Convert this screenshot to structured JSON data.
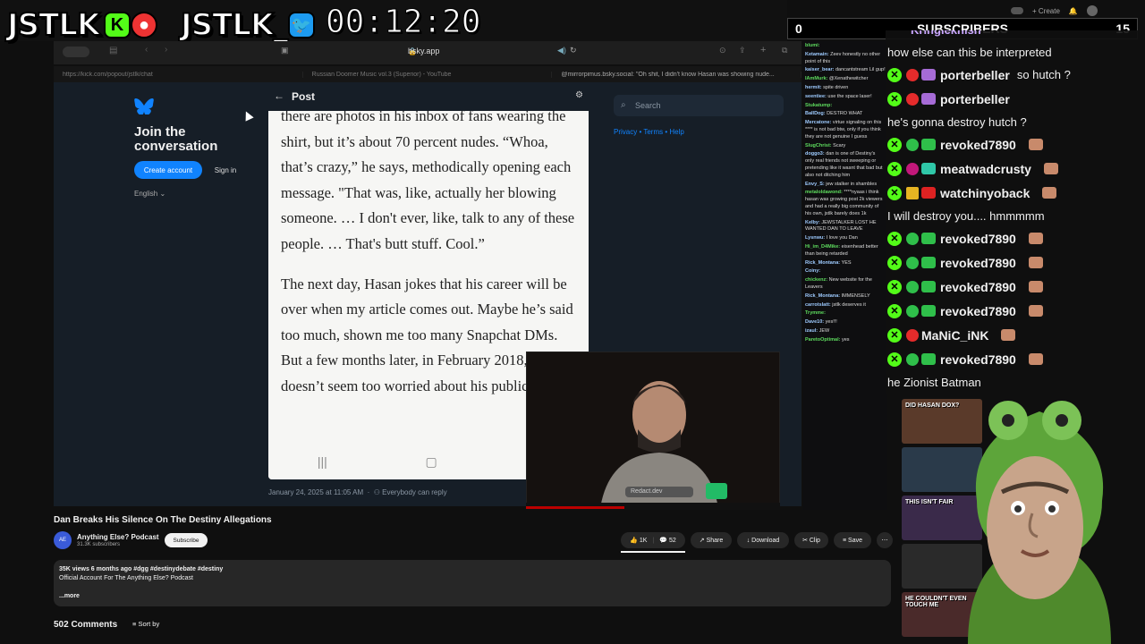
{
  "overlay": {
    "logo1": "JSTLK",
    "logo2": "JSTLK_",
    "kick_glyph": "K",
    "timer": "00:12:20"
  },
  "browser": {
    "url": "bsky.app",
    "tabs": [
      "https://kick.com/popout/jstlk/chat",
      "Russian Doomer Music vol.3 (Superior) - YouTube",
      "@mirrorpimus.bsky.social: \"Oh shit, I didn't know Hasan was showing nude..."
    ]
  },
  "bluesky": {
    "join_title": "Join the conversation",
    "create_account": "Create account",
    "sign_in": "Sign in",
    "language": "English",
    "post_title": "Post",
    "search_placeholder": "Search",
    "side_links": "Privacy • Terms • Help",
    "post_date": "January 24, 2025 at 11:05 AM",
    "reply_setting": "Everybody can reply"
  },
  "article": {
    "para1": "there are photos in his inbox of fans wearing the shirt, but it’s about 70 percent nudes. “Whoa, that’s crazy,” he says, methodically opening each message. \"That was, like, actually her blowing someone. … I don't ever, like, talk to any of these people. … That's butt stuff. Cool.”",
    "para2": "The next day, Hasan jokes that his career will be over when my article comes out. Maybe he’s said too much, shown me too many Snapchat DMs. But a few months later, in February 2018, he doesn’t seem too worried about his public"
  },
  "webcam": {
    "mic_label": "Redact.dev"
  },
  "youtube": {
    "title": "Dan Breaks His Silence On The Destiny Allegations",
    "channel": "Anything Else? Podcast",
    "channel_avatar": "AE",
    "subs": "31.3K subscribers",
    "subscribe": "Subscribe",
    "likes": "1K",
    "comments_icon_count": "52",
    "share": "Share",
    "download": "Download",
    "clip": "Clip",
    "save": "Save",
    "more": "⋯",
    "desc_line1": "35K views  6 months ago  #dgg #destinydebate #destiny",
    "desc_line2": "Official Account For The Anything Else? Podcast",
    "desc_more": "...more",
    "comments_count": "502 Comments",
    "sort_by": "Sort by"
  },
  "subscribers": {
    "left": "0",
    "label": "SUBSCRIBERS",
    "right": "15"
  },
  "top_right": {
    "create": "Create"
  },
  "small_chat": [
    {
      "user": "blumi:",
      "text": ""
    },
    {
      "user": "Ketamain:",
      "text": "Zeev honestly no other point of this"
    },
    {
      "user": "kaiser_bear:",
      "text": "dancantstream Lil gup!"
    },
    {
      "user": "IAmMurk:",
      "text": "@Xenathewitcher"
    },
    {
      "user": "hermit:",
      "text": "spite driven"
    },
    {
      "user": "seentiee:",
      "text": "use the space laser!"
    },
    {
      "user": "Stukatump:",
      "text": ""
    },
    {
      "user": "BallDog:",
      "text": "DESTRO WHAT"
    },
    {
      "user": "Mercatone:",
      "text": "virtue signaling on this **** is not bad btw, only if you think they are not genuine I guess"
    },
    {
      "user": "SlugChrist:",
      "text": "Scary"
    },
    {
      "user": "doggo3:",
      "text": "dan is one of Destiny's only real friends not sweeping or pretending like it wasnt that bad but also not ditching him"
    },
    {
      "user": "Envy_S:",
      "text": "jew stalker in shambles"
    },
    {
      "user": "metaloldawond:",
      "text": "****nyaas i think hasan was growing post 2k viewers and had a really big community of his own, jstlk barely does 1k"
    },
    {
      "user": "Kelby:",
      "text": "JEWSTALKER LOST HE WANTED DAN TO LEAVE"
    },
    {
      "user": "Lysnwu:",
      "text": "I love you Dan"
    },
    {
      "user": "Hi_im_D4Mike:",
      "text": "eisenhead better than being retarded"
    },
    {
      "user": "Rick_Montana:",
      "text": "YES"
    },
    {
      "user": "Coiny:",
      "text": ""
    },
    {
      "user": "chickenz:",
      "text": "New website for the Leavers"
    },
    {
      "user": "Rick_Montana:",
      "text": "IMMENSELY"
    },
    {
      "user": "carrotslatt:",
      "text": "jstlk deserves it"
    },
    {
      "user": "Trymme:",
      "text": ""
    },
    {
      "user": "Dave10:",
      "text": "yes!!!"
    },
    {
      "user": "izaul:",
      "text": "JEW"
    },
    {
      "user": "ParetoOptimal:",
      "text": "yes"
    }
  ],
  "big_chat": {
    "top_partial": "Kringlekhlsh",
    "lines": [
      {
        "type": "plain",
        "text": "how else can this be interpreted"
      },
      {
        "type": "user",
        "user": "porterbeller",
        "badge": "red",
        "sub": "purple",
        "msg": "so hutch ?"
      },
      {
        "type": "user",
        "user": "porterbeller",
        "badge": "red",
        "sub": "purple",
        "msg": ""
      },
      {
        "type": "plain",
        "text": "he's gonna destroy hutch ?"
      },
      {
        "type": "user",
        "user": "revoked7890",
        "badge": "green",
        "sub": "green",
        "msg": ""
      },
      {
        "type": "user",
        "user": "meatwadcrusty",
        "badge": "magenta",
        "sub": "teal",
        "msg": ""
      },
      {
        "type": "user",
        "user": "watchinyoback",
        "badge": "gold",
        "sub": "red",
        "msg": ""
      },
      {
        "type": "plain",
        "text": "I will destroy you.... hmmmmm"
      },
      {
        "type": "user",
        "user": "revoked7890",
        "badge": "green",
        "sub": "green",
        "msg": ""
      },
      {
        "type": "user",
        "user": "revoked7890",
        "badge": "green",
        "sub": "green",
        "msg": ""
      },
      {
        "type": "user",
        "user": "revoked7890",
        "badge": "green",
        "sub": "green",
        "msg": ""
      },
      {
        "type": "user",
        "user": "revoked7890",
        "badge": "green",
        "sub": "green",
        "msg": ""
      },
      {
        "type": "user",
        "user": "MaNiC_iNK",
        "badge": "red",
        "sub": "none",
        "msg": ""
      },
      {
        "type": "user",
        "user": "revoked7890",
        "badge": "green",
        "sub": "green",
        "msg": ""
      },
      {
        "type": "plain",
        "text": "he Zionist Batman"
      }
    ]
  },
  "thumbs": [
    {
      "label": "DID HASAN DOX?"
    },
    {
      "label": ""
    },
    {
      "label": "THIS ISN'T FAIR"
    },
    {
      "label": ""
    },
    {
      "label": "HE COULDN'T EVEN TOUCH ME"
    }
  ],
  "colors": {
    "kick_green": "#53fc18",
    "bsky_blue": "#1083fe",
    "yt_bg": "#0f0f0f"
  }
}
